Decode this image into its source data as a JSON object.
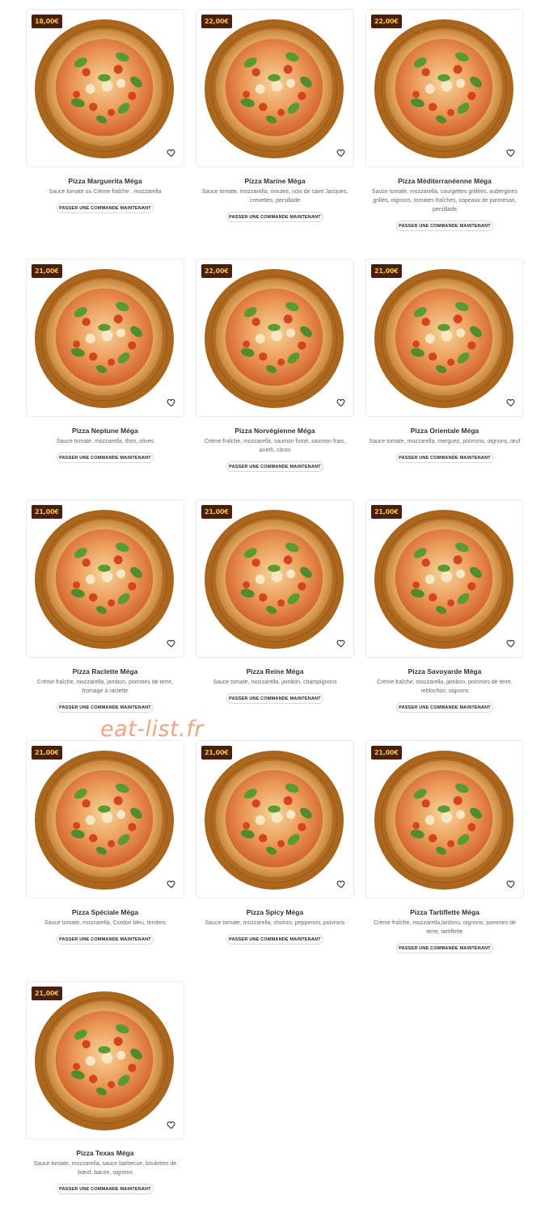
{
  "products": [
    {
      "name": "Pizza Marguerita Méga",
      "price": "18,00€",
      "desc": "Sauce tomate ou Crème fraîche , mozzarella",
      "button": "PASSER UNE COMMANDE MAINTENANT"
    },
    {
      "name": "Pizza Marine Méga",
      "price": "22,00€",
      "desc": "Sauce tomate, mozzarella, moules, noix de saint Jacques, crevettes, persillade",
      "button": "PASSER UNE COMMANDE MAINTENANT"
    },
    {
      "name": "Pizza Méditerranéenne Méga",
      "price": "22,00€",
      "desc": "Sauce tomate, mozzarella, courgettes grillées, aubergines grillés, oignons, tomates fraîches, copeaux de parmesan, persillade",
      "button": "PASSER UNE COMMANDE MAINTENANT"
    },
    {
      "name": "Pizza Neptune Méga",
      "price": "21,00€",
      "desc": "Sauce tomate, mozzarella, thon, olives",
      "button": "PASSER UNE COMMANDE MAINTENANT"
    },
    {
      "name": "Pizza Norvégienne Méga",
      "price": "22,00€",
      "desc": "Crème fraîche, mozzarella, saumon fumé, saumon frais, aneth, citron",
      "button": "PASSER UNE COMMANDE MAINTENANT"
    },
    {
      "name": "Pizza Orientale Méga",
      "price": "21,00€",
      "desc": "Sauce tomate, mozzarella, merguez, poivrons, oignons, œuf",
      "button": "PASSER UNE COMMANDE MAINTENANT"
    },
    {
      "name": "Pizza Raclette Méga",
      "price": "21,00€",
      "desc": "Crème fraîche, mozzarella, jambon, pommes de terre, fromage à raclette",
      "button": "PASSER UNE COMMANDE MAINTENANT"
    },
    {
      "name": "Pizza Reine Méga",
      "price": "21,00€",
      "desc": "Sauce tomate, mozzarella, jambon, champignons",
      "button": "PASSER UNE COMMANDE MAINTENANT"
    },
    {
      "name": "Pizza Savoyarde Méga",
      "price": "21,00€",
      "desc": "Crème fraîche, mozzarella, jambon, pommes de terre, reblochon, oignons",
      "button": "PASSER UNE COMMANDE MAINTENANT"
    },
    {
      "name": "Pizza Spéciale Méga",
      "price": "21,00€",
      "desc": "Sauce tomate, mozzarella, Cordon bleu, tenders",
      "button": "PASSER UNE COMMANDE MAINTENANT"
    },
    {
      "name": "Pizza Spicy Méga",
      "price": "21,00€",
      "desc": "Sauce tomate, mozzarella, chorizo, pepperoni, poivrons",
      "button": "PASSER UNE COMMANDE MAINTENANT"
    },
    {
      "name": "Pizza Tartiflette Méga",
      "price": "21,00€",
      "desc": "Crème fraîche, mozzarella,lardons, oignons, pommes de terre, tartiflette",
      "button": "PASSER UNE COMMANDE MAINTENANT"
    },
    {
      "name": "Pizza Texas Méga",
      "price": "21,00€",
      "desc": "Sauce tomate, mozzarella, sauce barbecue, boulettes de bœuf, bacon, oignons",
      "button": "PASSER UNE COMMANDE MAINTENANT"
    }
  ],
  "watermark": "eat-list.fr",
  "colors": {
    "price_bg": "#4a1f0e",
    "price_text": "#f2c24a",
    "watermark": "#f3a37d"
  },
  "icons": {
    "wishlist": "heart-icon"
  }
}
